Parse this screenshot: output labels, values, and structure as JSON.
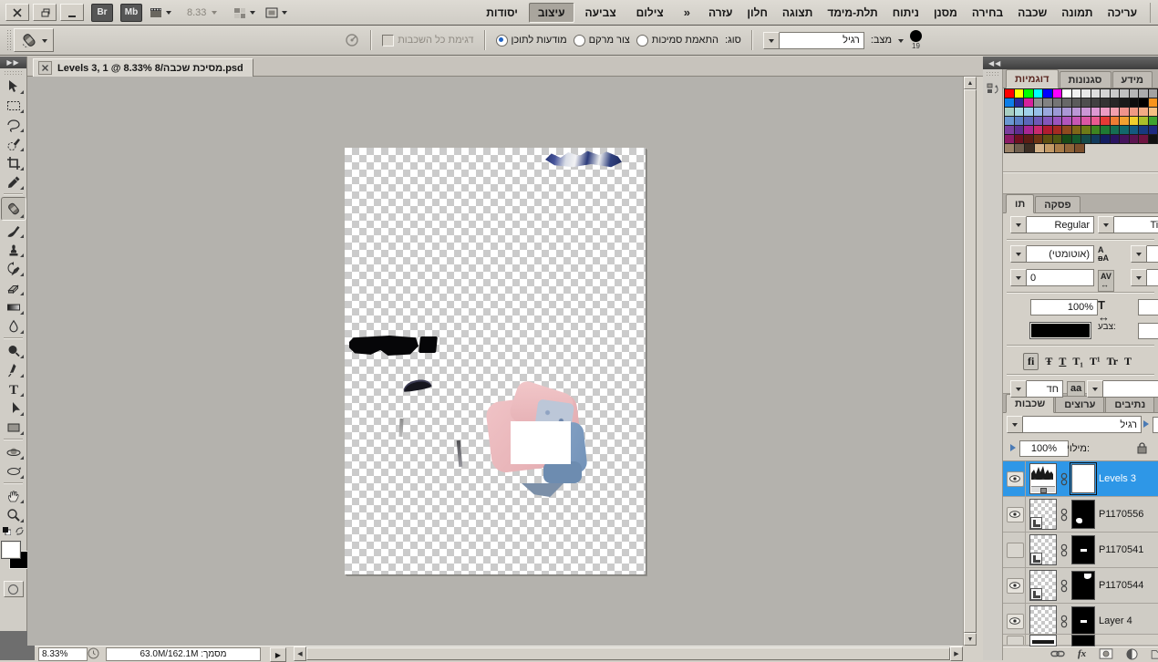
{
  "colors": {
    "chrome": "#d4d0c8",
    "selection_blue": "#2e97e7",
    "pasteboard_gray": "#b4b2ad",
    "dark_header": "#4a4a4a"
  },
  "app_bar": {
    "bridge_label": "Br",
    "minibridge_label": "Mb",
    "zoom_value": "8.33",
    "workspaces": [
      "יסודות",
      "עיצוב",
      "צביעה",
      "צילום"
    ],
    "active_workspace": "עיצוב",
    "overflow_chevron": "»"
  },
  "menu_bar": {
    "items": [
      "עריכה",
      "תמונה",
      "שכבה",
      "בחירה",
      "מסנן",
      "ניתוח",
      "תלת-מימד",
      "תצוגה",
      "חלון",
      "עזרה"
    ]
  },
  "options_bar": {
    "brush_size": "19",
    "mode_label": "מצב:",
    "mode_value": "רגיל",
    "type_label": "סוג:",
    "radio_options": [
      "התאמת סמיכות",
      "צור מרקם",
      "מודעות לתוכן"
    ],
    "selected_radio": "מודעות לתוכן",
    "sample_all_layers_label": "דגימת כל השכבות"
  },
  "document": {
    "tab_title": "Levels 3, 1 @ 8.33% 8/מסיכת שכבה.psd",
    "zoom": "8.33%",
    "status_label": "מסמך: 63.0M/162.1M"
  },
  "toolbar": {
    "tools": [
      {
        "id": "move"
      },
      {
        "id": "marquee"
      },
      {
        "id": "lasso"
      },
      {
        "id": "quick-select"
      },
      {
        "id": "crop"
      },
      {
        "id": "eyedropper"
      },
      {
        "id": "spot-healing",
        "selected": true,
        "divider_before": true
      },
      {
        "id": "brush"
      },
      {
        "id": "clone-stamp"
      },
      {
        "id": "history-brush"
      },
      {
        "id": "eraser"
      },
      {
        "id": "gradient"
      },
      {
        "id": "blur"
      },
      {
        "id": "dodge",
        "divider_before": true
      },
      {
        "id": "pen"
      },
      {
        "id": "type"
      },
      {
        "id": "path-select"
      },
      {
        "id": "shape"
      },
      {
        "id": "rotate-3d",
        "divider_before": true
      },
      {
        "id": "orbit-3d"
      },
      {
        "id": "hand",
        "divider_before": true
      },
      {
        "id": "zoom"
      }
    ]
  },
  "panels": {
    "swatches": {
      "tabs": [
        "דוגמיות",
        "סגנונות",
        "מידע"
      ],
      "active_tab": "דוגמיות",
      "rows": [
        [
          "#ff0000",
          "#ffff00",
          "#00ff00",
          "#00ffff",
          "#0000ff",
          "#ff00ff",
          "#ffffff",
          "#f2f2f2",
          "#e8e8e8",
          "#dedede",
          "#d4d4d4",
          "#cacaca",
          "#c0c0c0",
          "#b6b6b6",
          "#acacac",
          "#a2a2a2"
        ],
        [
          "#0d7ee8",
          "#28289b",
          "#d6219c",
          "#8f8f8f",
          "#828282",
          "#757575",
          "#686868",
          "#5b5b5b",
          "#4e4e4e",
          "#414141",
          "#343434",
          "#272727",
          "#1a1a1a",
          "#0d0d0d",
          "#000000",
          "#f7941d"
        ],
        [
          "#a9cfc2",
          "#aadce2",
          "#9fd0ea",
          "#96bfe8",
          "#9aa8dd",
          "#9c9ad6",
          "#ab97d6",
          "#bb97d6",
          "#cb97d6",
          "#dd99d3",
          "#ec9cc3",
          "#f2a0af",
          "#f0948c",
          "#ef9a84",
          "#f2ab84",
          "#f6c183"
        ],
        [
          "#6b98d2",
          "#5c7fc4",
          "#5b67b8",
          "#6e59b6",
          "#8457ba",
          "#9a55bd",
          "#b155bd",
          "#c756b5",
          "#da57a5",
          "#ea5a90",
          "#e53a36",
          "#ef7c34",
          "#f2a030",
          "#f0ce2c",
          "#aabf2a",
          "#3fa32f"
        ],
        [
          "#7b3f9e",
          "#5f2d90",
          "#a92692",
          "#c92a6e",
          "#b01c30",
          "#a52a22",
          "#8f4a1f",
          "#7f6618",
          "#6d7a17",
          "#3f8420",
          "#1f7a33",
          "#156f52",
          "#12696b",
          "#145a80",
          "#173a80",
          "#1f2a80"
        ],
        [
          "#8c1b66",
          "#6f1020",
          "#5c1d14",
          "#6e3414",
          "#5f4f12",
          "#4f5713",
          "#174a17",
          "#15592c",
          "#144a4a",
          "#123a5c",
          "#131d60",
          "#2a1460",
          "#45145c",
          "#5c1450",
          "#6e1440",
          "#121212"
        ],
        [
          "#9b8368",
          "#6f5e4e",
          "#3d2e24",
          "#d3b28a",
          "#c39a67",
          "#a87c49",
          "#90653a",
          "#7b4f2c"
        ]
      ]
    },
    "character": {
      "tabs": [
        "תו",
        "פסקה"
      ],
      "active_tab": "תו",
      "font_style": "Regular",
      "font_family": "Times",
      "leading_value": "(אוטומטי)",
      "tracking_value": "0",
      "vertical_scale": "100%",
      "color_label": "צבע:",
      "color_value": "#000000",
      "anti_alias_value": "חד",
      "aa_icon_label": "aa",
      "opentype_buttons": [
        "fi",
        "Ŧ",
        "T",
        "T₁",
        "T¹",
        "Tr",
        "T"
      ]
    },
    "layers": {
      "tabs": [
        "שכבות",
        "ערוצים",
        "נתיבים"
      ],
      "active_tab": "שכבות",
      "blend_mode": "רגיל",
      "fill_label": "מילוי:",
      "fill_value": "100%",
      "items": [
        {
          "name": "Levels 3",
          "visible": true,
          "selected": true,
          "thumb": "levels",
          "mask": "white",
          "link": true
        },
        {
          "name": "P1170556",
          "visible": true,
          "selected": false,
          "thumb": "smart",
          "mask": "black-blob",
          "link": true
        },
        {
          "name": "P1170541",
          "visible": false,
          "selected": false,
          "thumb": "smart",
          "mask": "black-dash",
          "link": true
        },
        {
          "name": "P1170544",
          "visible": true,
          "selected": false,
          "thumb": "smart",
          "mask": "black-top",
          "link": true
        },
        {
          "name": "Layer 4",
          "visible": true,
          "selected": false,
          "thumb": "plain",
          "mask": "black-dash",
          "link": true
        }
      ]
    }
  }
}
